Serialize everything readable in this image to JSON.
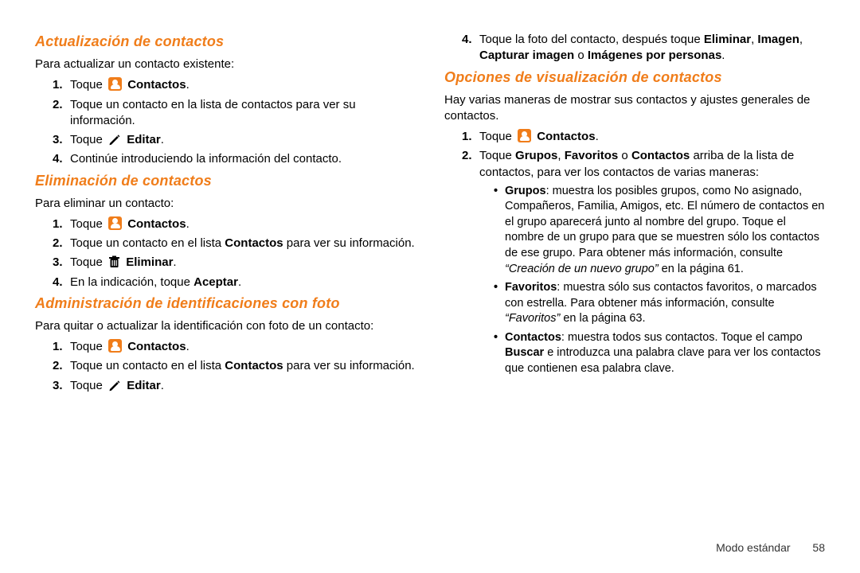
{
  "left": {
    "sec1": {
      "title": "Actualización de contactos",
      "intro": "Para actualizar un contacto existente:",
      "step1_pre": "Toque ",
      "step1_b": "Contactos",
      "step2": "Toque un contacto en la lista de contactos para ver su información.",
      "step3_pre": "Toque ",
      "step3_b": "Editar",
      "step4": "Continúe introduciendo la información del contacto."
    },
    "sec2": {
      "title": "Eliminación de contactos",
      "intro": "Para eliminar un contacto:",
      "step1_pre": "Toque ",
      "step1_b": "Contactos",
      "step2a": "Toque un contacto en el lista ",
      "step2b": "Contactos",
      "step2c": " para ver su información.",
      "step3_pre": "Toque ",
      "step3_b": "Eliminar",
      "step4a": "En la indicación, toque ",
      "step4b": "Aceptar"
    },
    "sec3": {
      "title": "Administración de identificaciones con foto",
      "intro": "Para quitar o actualizar la identificación con foto de un contacto:",
      "step1_pre": "Toque ",
      "step1_b": "Contactos",
      "step2a": "Toque un contacto en el lista ",
      "step2b": "Contactos",
      "step2c": " para ver su información.",
      "step3_pre": "Toque ",
      "step3_b": "Editar"
    }
  },
  "right": {
    "cont4a": "Toque la foto del contacto, después toque ",
    "cont4b": "Eliminar",
    "cont4c": ", ",
    "cont4d": "Imagen",
    "cont4e": ", ",
    "cont4f": "Capturar imagen",
    "cont4g": " o ",
    "cont4h": "Imágenes por personas",
    "sec4": {
      "title": "Opciones de visualización de contactos",
      "intro": "Hay varias maneras de mostrar sus contactos y ajustes generales de contactos.",
      "step1_pre": "Toque ",
      "step1_b": "Contactos",
      "step2a": "Toque ",
      "step2b": "Grupos",
      "step2c": ", ",
      "step2d": "Favoritos",
      "step2e": " o ",
      "step2f": "Contactos",
      "step2g": " arriba de la lista de contactos, para ver los contactos de varias maneras:",
      "bul1a": "Grupos",
      "bul1b": ": muestra los posibles grupos, como No asignado, Compañeros, Familia, Amigos, etc. El número de contactos en el grupo aparecerá junto al nombre del grupo. Toque el nombre de un grupo para que se muestren sólo los contactos de ese grupo. Para obtener más información, consulte ",
      "bul1c": "“Creación de un nuevo grupo”",
      "bul1d": " en la página 61.",
      "bul2a": "Favoritos",
      "bul2b": ": muestra sólo sus contactos favoritos, o marcados con estrella. Para obtener más información, consulte ",
      "bul2c": "“Favoritos”",
      "bul2d": " en la página 63.",
      "bul3a": "Contactos",
      "bul3b": ": muestra todos sus contactos. Toque el campo ",
      "bul3c": "Buscar",
      "bul3d": " e introduzca una palabra clave para ver los contactos que contienen esa palabra clave."
    }
  },
  "footer": {
    "label": "Modo estándar",
    "page": "58"
  }
}
